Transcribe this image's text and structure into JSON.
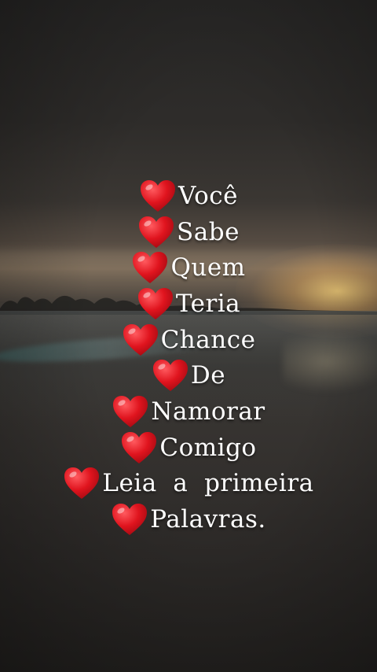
{
  "poem": {
    "lines": [
      {
        "icon": "red-heart-icon",
        "text": "Você"
      },
      {
        "icon": "red-heart-icon",
        "text": "Sabe"
      },
      {
        "icon": "red-heart-icon",
        "text": "Quem"
      },
      {
        "icon": "red-heart-icon",
        "text": "Teria"
      },
      {
        "icon": "red-heart-icon",
        "text": "Chance"
      },
      {
        "icon": "red-heart-icon",
        "text": "De"
      },
      {
        "icon": "red-heart-icon",
        "text": "Namorar"
      },
      {
        "icon": "red-heart-icon",
        "text": "Comigo"
      },
      {
        "icon": "red-heart-icon",
        "text": "Leia  a  primeira"
      },
      {
        "icon": "red-heart-icon",
        "text": "Palavras."
      }
    ]
  },
  "colors": {
    "text": "#ffffff",
    "heart": "#e0141e"
  }
}
